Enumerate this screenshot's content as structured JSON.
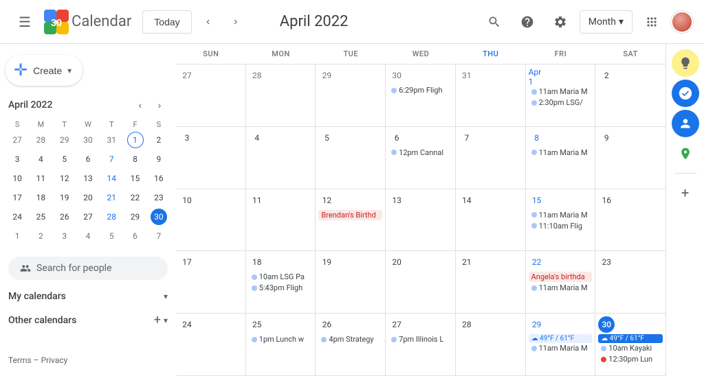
{
  "header": {
    "menu_label": "☰",
    "logo_text": "Calendar",
    "today_label": "Today",
    "nav_prev": "‹",
    "nav_next": "›",
    "month_year": "April 2022",
    "search_icon": "🔍",
    "help_icon": "?",
    "settings_icon": "⚙",
    "month_selector": "Month",
    "apps_icon": "⋮⋮⋮",
    "avatar_alt": "User avatar"
  },
  "sidebar": {
    "create_label": "Create",
    "mini_cal": {
      "title": "April 2022",
      "days_of_week": [
        "S",
        "M",
        "T",
        "W",
        "T",
        "F",
        "S"
      ],
      "weeks": [
        [
          {
            "d": "27",
            "other": true
          },
          {
            "d": "28",
            "other": true
          },
          {
            "d": "29",
            "other": true
          },
          {
            "d": "30",
            "other": true
          },
          {
            "d": "31",
            "other": true
          },
          {
            "d": "1",
            "today": false,
            "circle": true
          },
          {
            "d": "2"
          }
        ],
        [
          {
            "d": "3"
          },
          {
            "d": "4"
          },
          {
            "d": "5"
          },
          {
            "d": "6"
          },
          {
            "d": "7"
          },
          {
            "d": "8"
          },
          {
            "d": "9"
          }
        ],
        [
          {
            "d": "10"
          },
          {
            "d": "11"
          },
          {
            "d": "12"
          },
          {
            "d": "13"
          },
          {
            "d": "14"
          },
          {
            "d": "15"
          },
          {
            "d": "16"
          }
        ],
        [
          {
            "d": "17"
          },
          {
            "d": "18"
          },
          {
            "d": "19"
          },
          {
            "d": "20"
          },
          {
            "d": "21"
          },
          {
            "d": "22"
          },
          {
            "d": "23"
          }
        ],
        [
          {
            "d": "24"
          },
          {
            "d": "25"
          },
          {
            "d": "26"
          },
          {
            "d": "27"
          },
          {
            "d": "28"
          },
          {
            "d": "29"
          },
          {
            "d": "30",
            "selected": true
          }
        ],
        [
          {
            "d": "1",
            "other": true
          },
          {
            "d": "2",
            "other": true
          },
          {
            "d": "3",
            "other": true
          },
          {
            "d": "4",
            "other": true
          },
          {
            "d": "5",
            "other": true
          },
          {
            "d": "6",
            "other": true
          },
          {
            "d": "7",
            "other": true
          }
        ]
      ]
    },
    "search_people_placeholder": "Search for people",
    "my_calendars_label": "My calendars",
    "other_calendars_label": "Other calendars",
    "terms_label": "Terms",
    "privacy_label": "Privacy"
  },
  "calendar": {
    "day_headers": [
      "SUN",
      "MON",
      "TUE",
      "WED",
      "THU",
      "FRI",
      "SAT"
    ],
    "weeks": [
      {
        "days": [
          {
            "date": "27",
            "cur_month": false,
            "events": []
          },
          {
            "date": "28",
            "cur_month": false,
            "events": []
          },
          {
            "date": "29",
            "cur_month": false,
            "events": []
          },
          {
            "date": "30",
            "cur_month": false,
            "events": [
              {
                "type": "dot",
                "color": "blue",
                "text": "6:29pm Fligh"
              }
            ]
          },
          {
            "date": "31",
            "cur_month": false,
            "events": []
          },
          {
            "date": "Apr 1",
            "cur_month": true,
            "fri": true,
            "events": [
              {
                "type": "dot",
                "color": "blue",
                "text": "11am Maria M"
              },
              {
                "type": "dot",
                "color": "blue",
                "text": "2:30pm LSG/"
              }
            ]
          },
          {
            "date": "2",
            "cur_month": true,
            "events": []
          }
        ]
      },
      {
        "days": [
          {
            "date": "3",
            "cur_month": true,
            "events": []
          },
          {
            "date": "4",
            "cur_month": true,
            "events": []
          },
          {
            "date": "5",
            "cur_month": true,
            "events": []
          },
          {
            "date": "6",
            "cur_month": true,
            "events": [
              {
                "type": "dot",
                "color": "blue",
                "text": "12pm Cannal"
              }
            ]
          },
          {
            "date": "7",
            "cur_month": true,
            "events": []
          },
          {
            "date": "8",
            "cur_month": true,
            "fri": true,
            "events": [
              {
                "type": "dot",
                "color": "blue",
                "text": "11am Maria M"
              }
            ]
          },
          {
            "date": "9",
            "cur_month": true,
            "events": []
          }
        ]
      },
      {
        "days": [
          {
            "date": "10",
            "cur_month": true,
            "events": []
          },
          {
            "date": "11",
            "cur_month": true,
            "events": []
          },
          {
            "date": "12",
            "cur_month": true,
            "events": [
              {
                "type": "birthday",
                "text": "Brendan's Birthd"
              }
            ]
          },
          {
            "date": "13",
            "cur_month": true,
            "events": []
          },
          {
            "date": "14",
            "cur_month": true,
            "events": []
          },
          {
            "date": "15",
            "cur_month": true,
            "fri": true,
            "events": [
              {
                "type": "dot",
                "color": "blue",
                "text": "11am Maria M"
              },
              {
                "type": "dot",
                "color": "blue",
                "text": "11:10am Flig"
              }
            ]
          },
          {
            "date": "16",
            "cur_month": true,
            "events": []
          }
        ]
      },
      {
        "days": [
          {
            "date": "17",
            "cur_month": true,
            "events": []
          },
          {
            "date": "18",
            "cur_month": true,
            "events": [
              {
                "type": "dot",
                "color": "blue",
                "text": "10am LSG Pa"
              },
              {
                "type": "dot",
                "color": "blue",
                "text": "5:43pm Fligh"
              }
            ]
          },
          {
            "date": "19",
            "cur_month": true,
            "events": []
          },
          {
            "date": "20",
            "cur_month": true,
            "events": []
          },
          {
            "date": "21",
            "cur_month": true,
            "events": []
          },
          {
            "date": "22",
            "cur_month": true,
            "fri": true,
            "events": [
              {
                "type": "birthday",
                "text": "Angela's birthda"
              },
              {
                "type": "dot",
                "color": "blue",
                "text": "11am Maria M"
              }
            ]
          },
          {
            "date": "23",
            "cur_month": true,
            "events": []
          }
        ]
      },
      {
        "days": [
          {
            "date": "24",
            "cur_month": true,
            "events": []
          },
          {
            "date": "25",
            "cur_month": true,
            "events": [
              {
                "type": "dot",
                "color": "blue",
                "text": "1pm Lunch w"
              }
            ]
          },
          {
            "date": "26",
            "cur_month": true,
            "events": [
              {
                "type": "dot",
                "color": "blue",
                "text": "4pm Strategy"
              }
            ]
          },
          {
            "date": "27",
            "cur_month": true,
            "events": [
              {
                "type": "dot",
                "color": "blue",
                "text": "7pm Illinois L"
              }
            ]
          },
          {
            "date": "28",
            "cur_month": true,
            "events": []
          },
          {
            "date": "29",
            "cur_month": true,
            "fri": true,
            "events": [
              {
                "type": "weather",
                "text": "49°F / 61°F"
              },
              {
                "type": "dot",
                "color": "blue",
                "text": "11am Maria M"
              }
            ]
          },
          {
            "date": "30",
            "cur_month": true,
            "today": true,
            "events": [
              {
                "type": "weather-today",
                "text": "49°F / 61°F"
              },
              {
                "type": "dot",
                "color": "blue",
                "text": "10am Kayaki"
              },
              {
                "type": "dot",
                "color": "red",
                "text": "12:30pm Lun"
              }
            ]
          }
        ]
      }
    ]
  }
}
